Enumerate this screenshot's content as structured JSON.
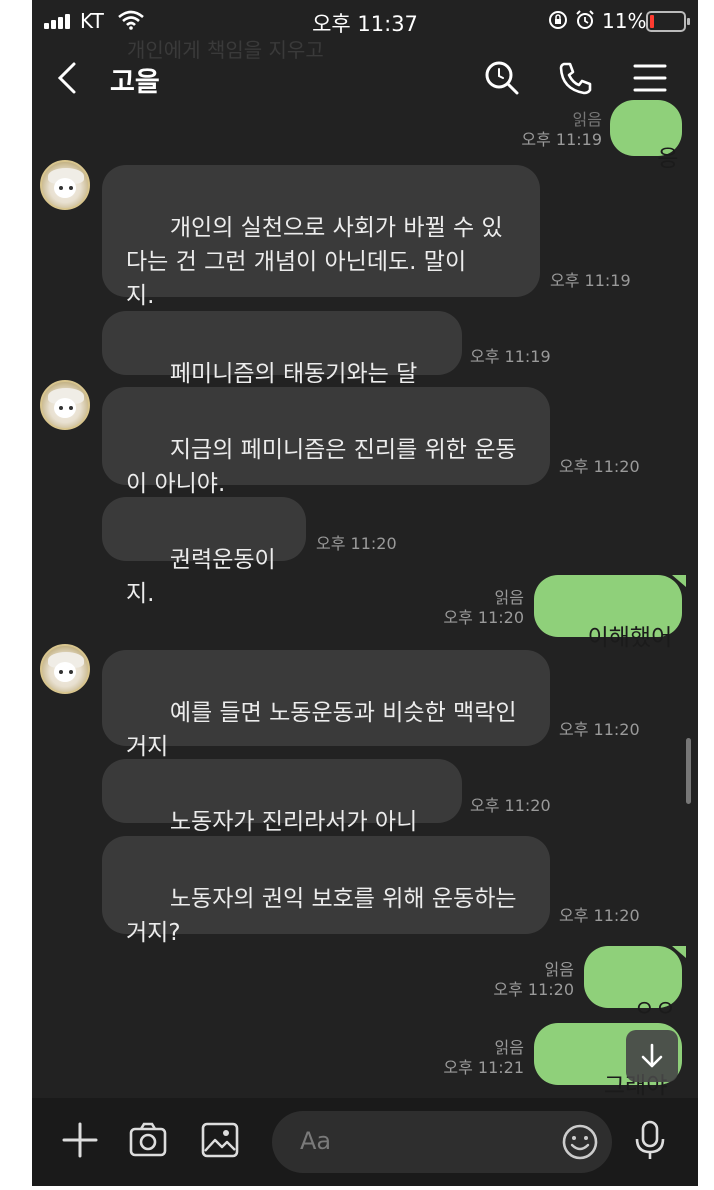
{
  "status": {
    "carrier": "KT",
    "time": "오후 11:37",
    "battery_pct": "11%"
  },
  "header": {
    "title": "고을",
    "ghost_text": "개인에게 책임을 지우고"
  },
  "messages": [
    {
      "dir": "out",
      "text": "응",
      "read": "읽음",
      "time": "오후 11:19"
    },
    {
      "dir": "in",
      "text": "개인의 실천으로 사회가 바뀔 수 있\n다는 건 그런 개념이 아닌데도. 말이\n지.",
      "time": "오후 11:19"
    },
    {
      "dir": "in",
      "text": "페미니즘의 태동기와는 달리",
      "time": "오후 11:19"
    },
    {
      "dir": "in",
      "text": "지금의 페미니즘은 진리를 위한 운동\n이 아니야.",
      "time": "오후 11:20"
    },
    {
      "dir": "in",
      "text": "권력운동이지.",
      "time": "오후 11:20"
    },
    {
      "dir": "out",
      "text": "이해했어",
      "read": "읽음",
      "time": "오후 11:20"
    },
    {
      "dir": "in",
      "text": "예를 들면 노동운동과 비슷한 맥락인\n거지",
      "time": "오후 11:20"
    },
    {
      "dir": "in",
      "text": "노동자가 진리라서가 아니라",
      "time": "오후 11:20"
    },
    {
      "dir": "in",
      "text": "노동자의 권익 보호를 위해 운동하는\n거지?",
      "time": "오후 11:20"
    },
    {
      "dir": "out",
      "text": "ㅇㅇ",
      "read": "읽음",
      "time": "오후 11:20"
    },
    {
      "dir": "out",
      "text": "그래야",
      "read": "읽음",
      "time": "오후 11:21"
    }
  ],
  "input": {
    "placeholder": "Aa"
  },
  "colors": {
    "background": "#222222",
    "incoming_bubble": "#3a3a3a",
    "outgoing_bubble": "#8fd07a"
  },
  "icons": [
    "back-icon",
    "search-icon",
    "phone-icon",
    "menu-icon",
    "plus-icon",
    "camera-icon",
    "gallery-icon",
    "emoji-icon",
    "mic-icon",
    "scroll-down-icon"
  ]
}
